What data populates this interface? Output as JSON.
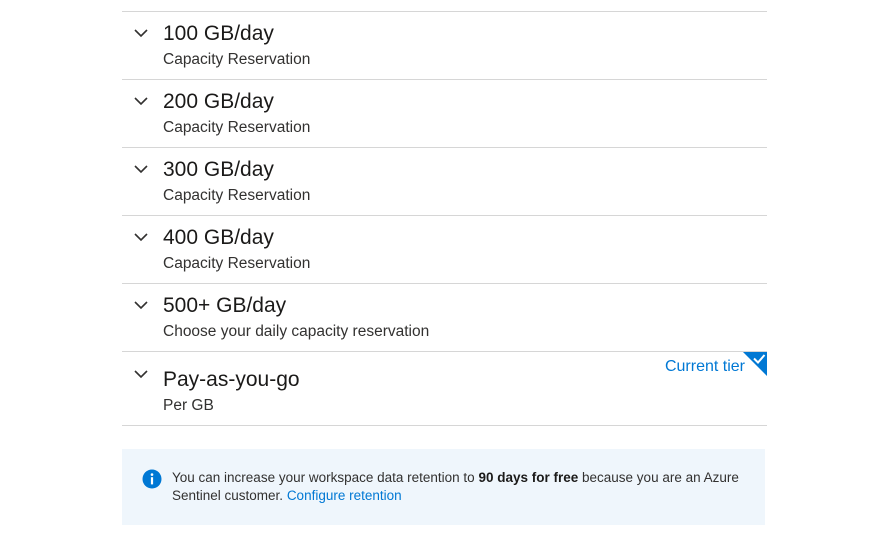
{
  "tiers": [
    {
      "title": "100 GB/day",
      "subtitle": "Capacity Reservation"
    },
    {
      "title": "200 GB/day",
      "subtitle": "Capacity Reservation"
    },
    {
      "title": "300 GB/day",
      "subtitle": "Capacity Reservation"
    },
    {
      "title": "400 GB/day",
      "subtitle": "Capacity Reservation"
    },
    {
      "title": "500+ GB/day",
      "subtitle": "Choose your daily capacity reservation"
    },
    {
      "title": "Pay-as-you-go",
      "subtitle": "Per GB",
      "badge": "Current tier"
    }
  ],
  "info": {
    "icon": "info-icon",
    "text_before": "You can increase your workspace data retention to ",
    "text_bold": "90 days for free",
    "text_after": " because you are an Azure Sentinel customer. ",
    "link_label": "Configure retention"
  },
  "colors": {
    "accent": "#0078d4",
    "divider": "#d6d6d6",
    "info_background": "#eff6fc"
  }
}
